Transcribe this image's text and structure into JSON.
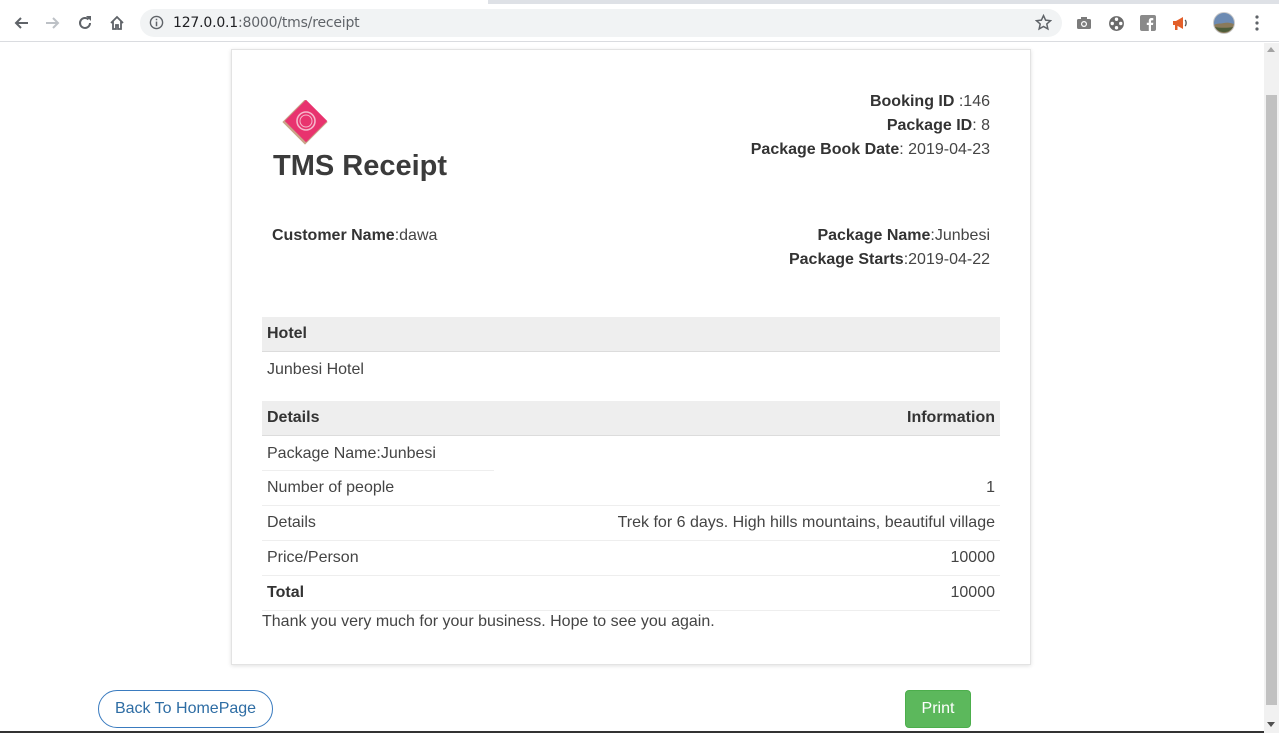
{
  "browser": {
    "url_host": "127.0.0.1",
    "url_path": ":8000/tms/receipt",
    "icons": [
      "back-arrow-icon",
      "forward-arrow-icon",
      "reload-icon",
      "home-icon",
      "info-icon",
      "star-icon",
      "camera-icon",
      "film-reel-icon",
      "facebook-icon",
      "megaphone-icon",
      "profile-avatar",
      "kebab-menu-icon"
    ]
  },
  "receipt": {
    "title": "TMS Receipt",
    "booking_id_label": "Booking ID",
    "booking_id_value": " :146",
    "package_id_label": "Package ID",
    "package_id_value": ": 8",
    "book_date_label": "Package Book Date",
    "book_date_value": ": 2019-04-23",
    "customer_name_label": "Customer Name",
    "customer_name_value": ":dawa",
    "package_name_label": "Package Name",
    "package_name_value": ":Junbesi",
    "package_starts_label": "Package Starts",
    "package_starts_value": ":2019-04-22"
  },
  "hotel_table": {
    "header": "Hotel",
    "value": "Junbesi Hotel"
  },
  "details_table": {
    "header_left": "Details",
    "header_right": "Information",
    "rows": [
      {
        "label": "Package Name:Junbesi",
        "value": ""
      },
      {
        "label": "Number of people",
        "value": "1"
      },
      {
        "label": "Details",
        "value": "Trek for 6 days. High hills mountains, beautiful village"
      },
      {
        "label": "Price/Person",
        "value": "10000"
      },
      {
        "label": "Total",
        "value": "10000"
      }
    ]
  },
  "thanks": "Thank you very much for your business. Hope to see you again.",
  "actions": {
    "back_label": "Back To HomePage",
    "print_label": "Print"
  },
  "colors": {
    "print_button": "#5cb85c",
    "back_button_border": "#3a7bbf",
    "logo_pink": "#e8336e",
    "logo_tan": "#c9a489"
  }
}
